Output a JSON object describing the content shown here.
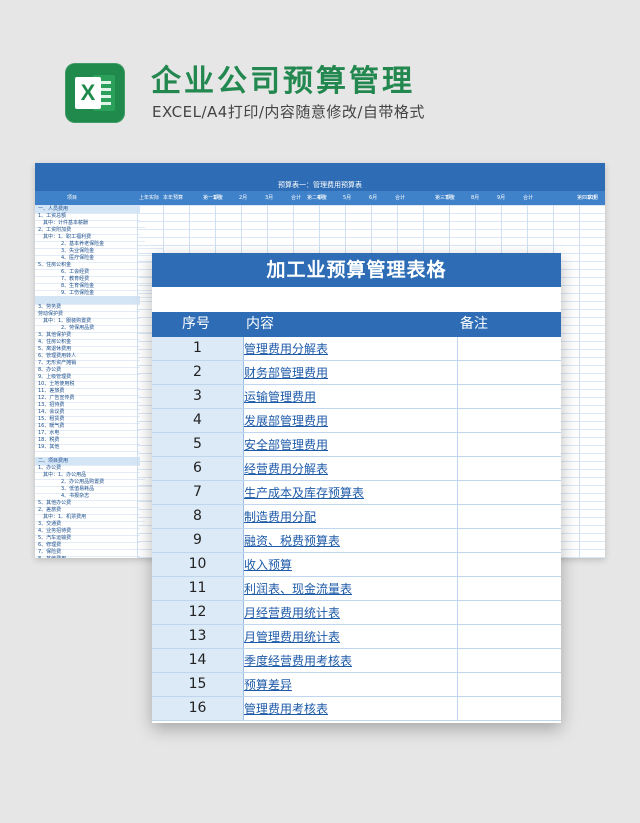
{
  "header": {
    "title": "企业公司预算管理",
    "subtitle": "EXCEL/A4打印/内容随意修改/自带格式",
    "icon_letter": "X"
  },
  "background_sheet": {
    "banner_title": "预算表一：管理费用预算表",
    "header_cells": [
      "项目",
      "上年实际",
      "本年预算",
      "第一季度",
      "1月",
      "2月",
      "3月",
      "合计",
      "第二季度",
      "4月",
      "5月",
      "6月",
      "合计",
      "第三季度",
      "7月",
      "8月",
      "9月",
      "合计",
      "第四季度",
      "10月"
    ],
    "col_lines": [
      "一、人员费用",
      "1、工资总额",
      "其中：计件基本薪酬",
      "2、工资附加费",
      "其中：1、职工福利费",
      "2、基本养老保险金",
      "3、失业保险金",
      "4、医疗保险金",
      "5、住房公积金",
      "6、工会经费",
      "7、教育经费",
      "8、生育保险金",
      "9、工伤保险金",
      "",
      "3、劳务费",
      "劳动保护费",
      "其中：1、服装购置费",
      "2、劳保用品费",
      "3、其他保护费",
      "4、住房公积金",
      "5、离退休费用",
      "6、管理费用转人",
      "7、无形资产摊销",
      "8、办公费",
      "9、上级管理费",
      "10、土地使用税",
      "11、差旅费",
      "12、广告宣传费",
      "13、招待费",
      "14、会议费",
      "15、租赁费",
      "16、暖气费",
      "17、水电",
      "18、税费",
      "19、其他",
      "",
      "二、项目费用",
      "1、办公费",
      "其中：1、办公用品",
      "2、办公用品购置费",
      "3、低值易耗品",
      "4、书报杂志",
      "5、其他办公费",
      "2、差旅费",
      "其中：1、机票费用",
      "3、交通费",
      "4、业务招待费",
      "5、汽车运输费",
      "6、修理费",
      "7、保险费",
      "8、其他费用"
    ],
    "highlight_rows": [
      0,
      13,
      36
    ]
  },
  "card": {
    "title": "加工业预算管理表格",
    "columns": {
      "index": "序号",
      "content": "内容",
      "note": "备注"
    },
    "rows": [
      {
        "index": "1",
        "content": "管理费用分解表"
      },
      {
        "index": "2",
        "content": "财务部管理费用"
      },
      {
        "index": "3",
        "content": "运输管理费用"
      },
      {
        "index": "4",
        "content": "发展部管理费用"
      },
      {
        "index": "5",
        "content": "安全部管理费用"
      },
      {
        "index": "6",
        "content": "经营费用分解表"
      },
      {
        "index": "7",
        "content": "生产成本及库存预算表"
      },
      {
        "index": "8",
        "content": "制造费用分配"
      },
      {
        "index": "9",
        "content": "融资、税费预算表"
      },
      {
        "index": "10",
        "content": "收入预算"
      },
      {
        "index": "11",
        "content": "利润表、现金流量表"
      },
      {
        "index": "12",
        "content": "月经营费用统计表"
      },
      {
        "index": "13",
        "content": "月管理费用统计表"
      },
      {
        "index": "14",
        "content": "季度经营费用考核表"
      },
      {
        "index": "15",
        "content": "预算差异"
      },
      {
        "index": "16",
        "content": "管理费用考核表"
      }
    ]
  }
}
